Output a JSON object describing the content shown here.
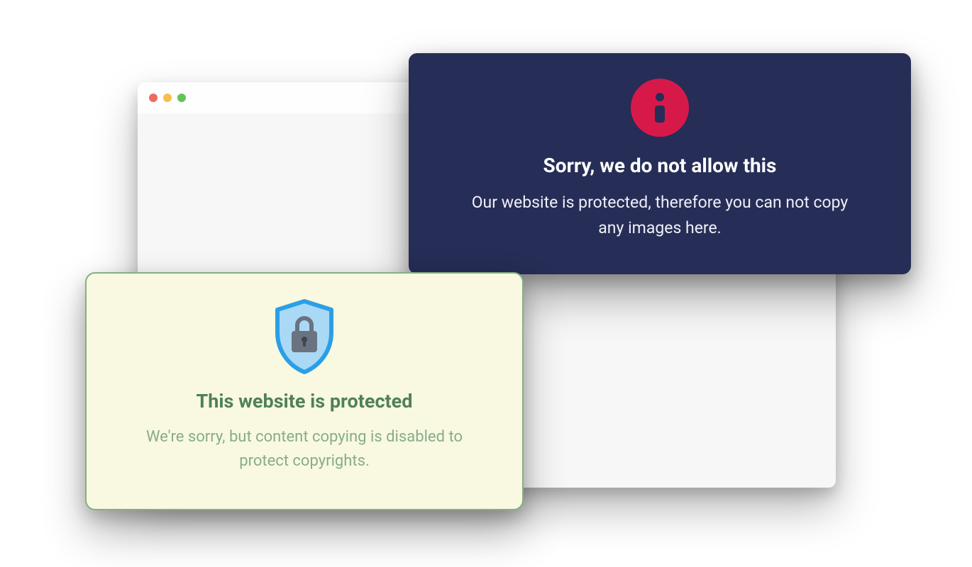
{
  "dark_alert": {
    "title": "Sorry, we do not allow this",
    "body": "Our website is protected, therefore you can not copy any images here."
  },
  "light_alert": {
    "title": "This website is protected",
    "body": "We're sorry, but content copying is disabled to protect copyrights."
  },
  "colors": {
    "dark_bg": "#262d56",
    "info_badge": "#d7194a",
    "light_bg": "#f8f9e0",
    "light_border": "#86af80",
    "light_title": "#518156",
    "light_body": "#88ac8a"
  }
}
